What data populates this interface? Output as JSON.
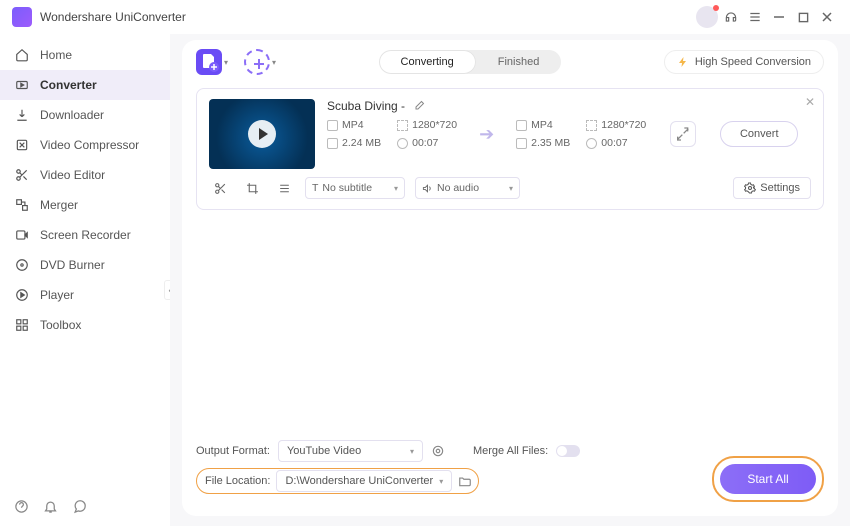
{
  "app": {
    "title": "Wondershare UniConverter"
  },
  "sidebar": {
    "items": [
      {
        "label": "Home"
      },
      {
        "label": "Converter"
      },
      {
        "label": "Downloader"
      },
      {
        "label": "Video Compressor"
      },
      {
        "label": "Video Editor"
      },
      {
        "label": "Merger"
      },
      {
        "label": "Screen Recorder"
      },
      {
        "label": "DVD Burner"
      },
      {
        "label": "Player"
      },
      {
        "label": "Toolbox"
      }
    ]
  },
  "tabs": {
    "converting": "Converting",
    "finished": "Finished"
  },
  "high_speed_label": "High Speed Conversion",
  "file": {
    "name": "Scuba Diving  -",
    "src": {
      "format": "MP4",
      "size": "2.24 MB",
      "res": "1280*720",
      "dur": "00:07"
    },
    "dst": {
      "format": "MP4",
      "size": "2.35 MB",
      "res": "1280*720",
      "dur": "00:07"
    },
    "convert_label": "Convert",
    "subtitle": "No subtitle",
    "audio": "No audio",
    "settings_label": "Settings"
  },
  "bottom": {
    "output_format_label": "Output Format:",
    "output_format_value": "YouTube Video",
    "merge_label": "Merge All Files:",
    "file_location_label": "File Location:",
    "file_location_value": "D:\\Wondershare  UniConverter",
    "start_all": "Start All"
  }
}
